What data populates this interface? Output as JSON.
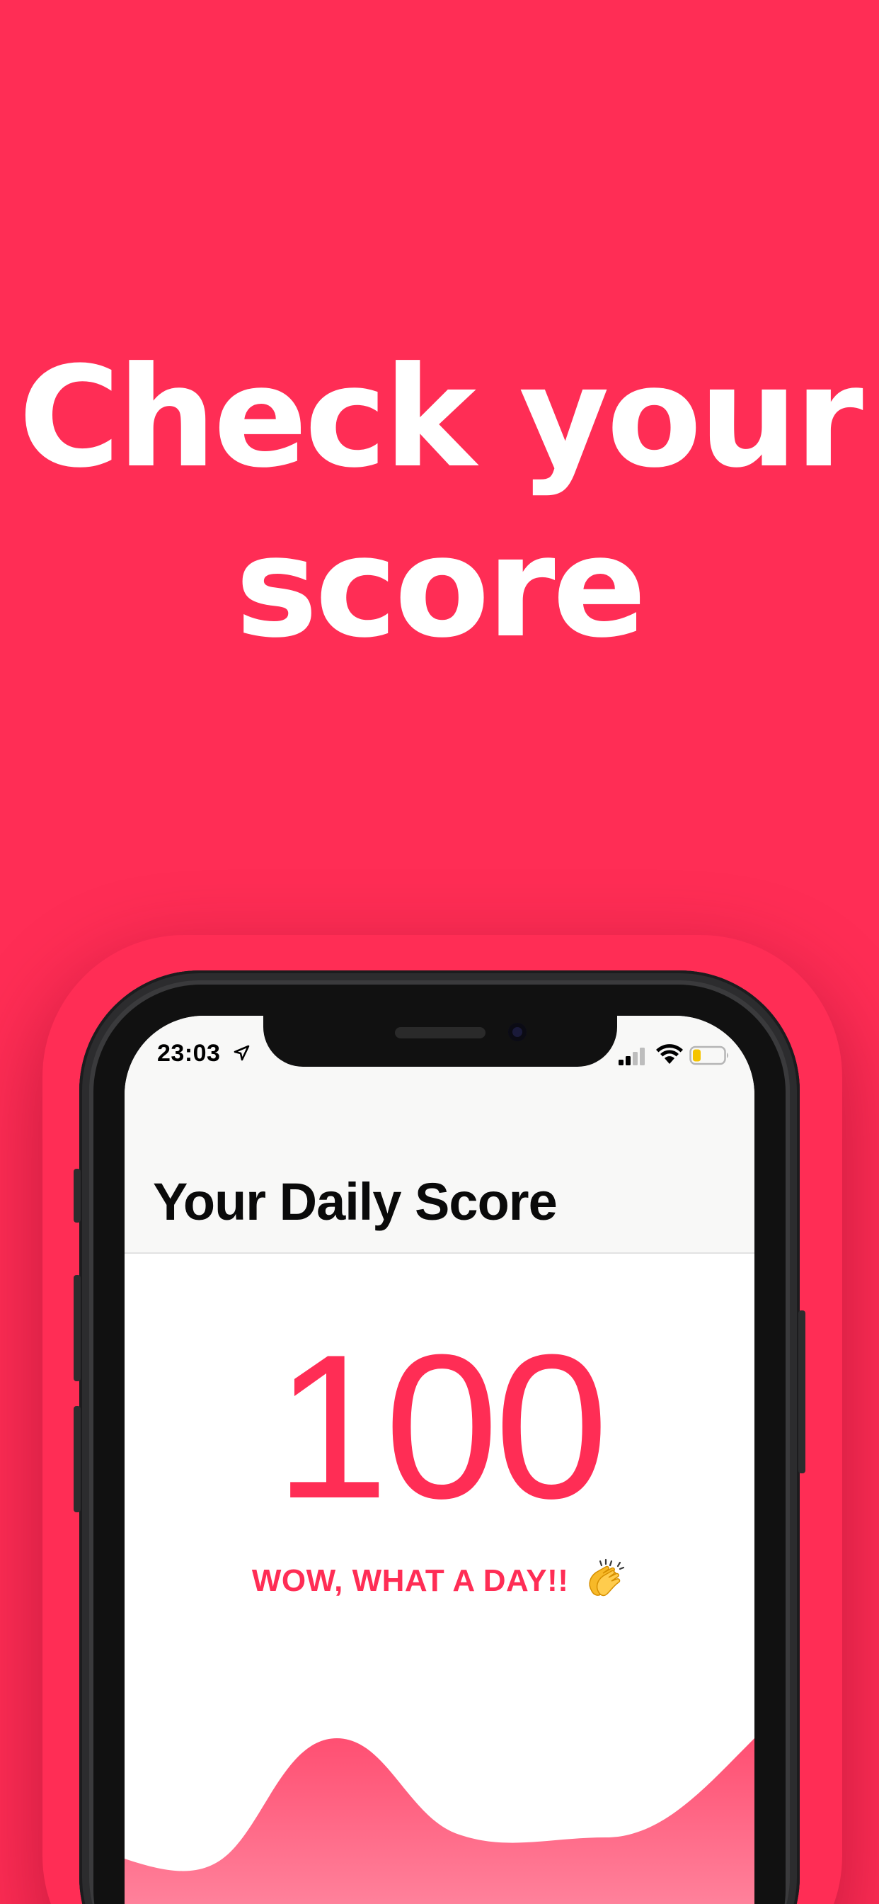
{
  "headline": {
    "line1": "Check your",
    "line2": "score"
  },
  "status_bar": {
    "time": "23:03",
    "icons": [
      "location-arrow-icon",
      "cellular-signal-icon",
      "wifi-icon",
      "battery-low-icon"
    ],
    "battery_color": "#F5C400"
  },
  "screen": {
    "title": "Your Daily Score",
    "score": "100",
    "message": "WOW, WHAT A DAY!!",
    "message_emoji_icon": "clapping-hands-icon"
  },
  "colors": {
    "accent": "#FF2D55",
    "background": "#FF2D55",
    "headline_text": "#FFFFFF",
    "nav_background": "#F8F8F7",
    "wave_top": "#FF4F72",
    "wave_bottom": "#FF8FA6"
  }
}
